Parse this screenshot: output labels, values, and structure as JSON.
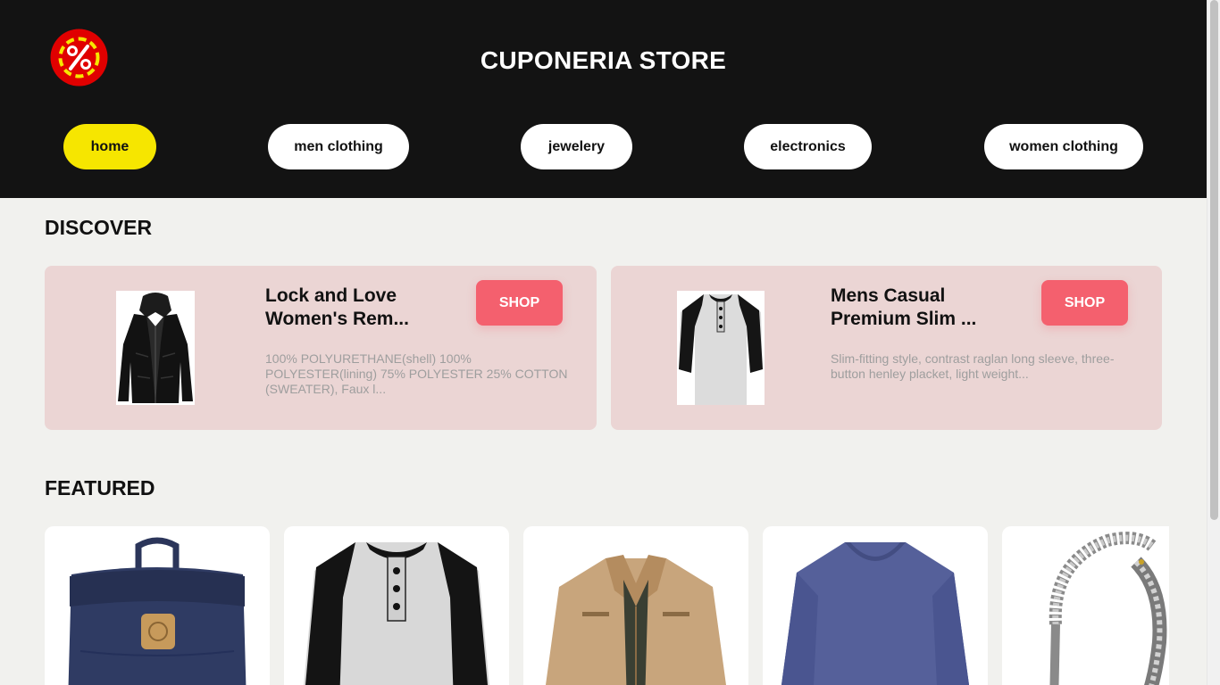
{
  "header": {
    "title": "CUPONERIA STORE",
    "logo_icon": "percent-badge-icon"
  },
  "nav": [
    {
      "label": "home",
      "active": true
    },
    {
      "label": "men clothing",
      "active": false
    },
    {
      "label": "jewelery",
      "active": false
    },
    {
      "label": "electronics",
      "active": false
    },
    {
      "label": "women clothing",
      "active": false
    }
  ],
  "discover": {
    "title": "DISCOVER",
    "cards": [
      {
        "name": "Lock and Love Women's Rem...",
        "description": "100% POLYURETHANE(shell) 100% POLYESTER(lining) 75% POLYESTER 25% COTTON (SWEATER), Faux l...",
        "button": "SHOP",
        "image_icon": "leather-jacket-image"
      },
      {
        "name": "Mens Casual Premium Slim ...",
        "description": "Slim-fitting style, contrast raglan long sleeve, three-button henley placket, light weight...",
        "button": "SHOP",
        "image_icon": "henley-shirt-image"
      }
    ]
  },
  "featured": {
    "title": "FEATURED",
    "items": [
      {
        "image_icon": "backpack-image"
      },
      {
        "image_icon": "henley-shirt-image"
      },
      {
        "image_icon": "cotton-jacket-image"
      },
      {
        "image_icon": "slim-fit-tshirt-image"
      },
      {
        "image_icon": "dragon-bracelet-image"
      }
    ]
  },
  "colors": {
    "header_bg": "#131313",
    "accent_yellow": "#f6e600",
    "shop_button": "#f4606e",
    "discover_card_bg": "#ebd5d4",
    "page_bg": "#f1f1ee"
  }
}
